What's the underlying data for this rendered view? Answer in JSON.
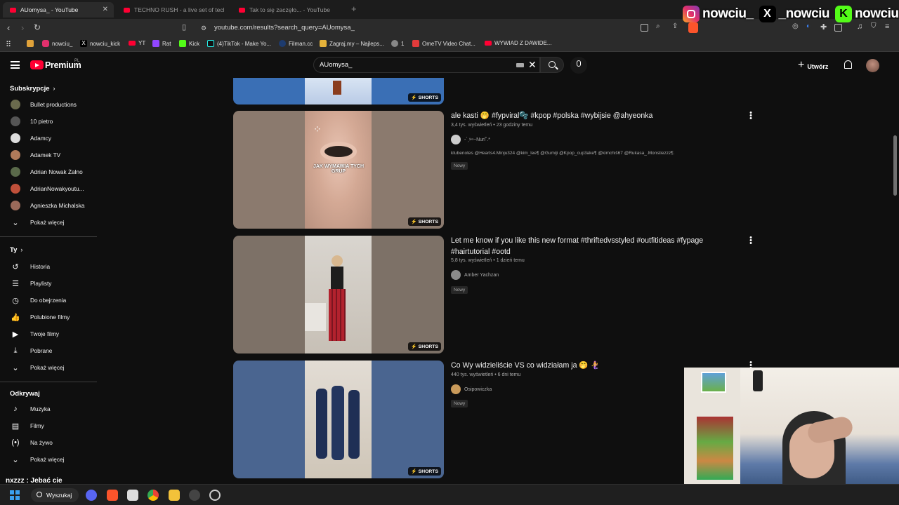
{
  "browser": {
    "tabs": [
      {
        "title": "AUomysa_ - YouTube",
        "active": true
      },
      {
        "title": "TECHNO RUSH - a live set of techno",
        "active": false
      },
      {
        "title": "Tak to się zaczęło... - YouTube",
        "active": false
      }
    ],
    "url": "youtube.com/results?search_query=AUomysa_",
    "bookmarks": [
      "nowciu_",
      "nowciu_kick",
      "YT",
      "Rat",
      "Kick",
      "(4)TikTok - Make Yo...",
      "Filman.cc",
      "Zagraj.my – Najleps...",
      "1",
      "OmeTV Video Chat...",
      "WYWIAD Z DAWIDE..."
    ]
  },
  "overlay": {
    "socials": [
      {
        "handle": "nowciu_",
        "icon": "instagram-icon",
        "color": "#e1306c"
      },
      {
        "handle": "_nowciu",
        "icon": "x-icon",
        "color": "#000000"
      },
      {
        "handle": "nowciu",
        "icon": "kick-icon",
        "color": "#53fc18"
      }
    ],
    "chat_message": "nxzzz : Jebać cie"
  },
  "youtube": {
    "brand": "Premium",
    "region": "PL",
    "search_query": "AUomysa_",
    "create_label": "Utwórz"
  },
  "sidebar": {
    "subscriptions_header": "Subskrypcje",
    "subscriptions": [
      "Bullet productions",
      "10 pietro",
      "Adamcy",
      "Adamek TV",
      "Adrian Nowak Żalno",
      "AdrianNowakyoutu...",
      "Agnieszka Michalska"
    ],
    "show_more_1": "Pokaż więcej",
    "you_header": "Ty",
    "you_items": [
      "Historia",
      "Playlisty",
      "Do obejrzenia",
      "Polubione filmy",
      "Twoje filmy",
      "Pobrane"
    ],
    "show_more_2": "Pokaż więcej",
    "explore_header": "Odkrywaj",
    "explore_items": [
      "Muzyka",
      "Filmy",
      "Na żywo"
    ],
    "show_more_3": "Pokaż więcej"
  },
  "results": [
    {
      "title": "ale kasti 🤭 #fypviral🫧 #kpop #polska #wybijsie @ahyeonka",
      "meta": "3,4 tys. wyświetleń • 23 godziny temu",
      "channel": "-ˋˏ✄┈Nuri˚.*",
      "description": "ktubenotes @Hearts4.Minju324 @kim_lee¶ @Gumiji @Kpop_cup3ake¶ @kimchiš67 @Rukasa_.Monstiezzz¶.",
      "badge": "Nowy",
      "shorts_label": "SHORTS",
      "thumb_text": "JAK WYMAWIA TYCH GRUP"
    },
    {
      "title": "Let me know if you like this new format #thriftedvsstyled #outfitideas #fypage #hairtutorial #ootd",
      "meta": "5,8 tys. wyświetleń • 1 dzień temu",
      "channel": "Amber Yachzan",
      "badge": "Nowy",
      "shorts_label": "SHORTS"
    },
    {
      "title": "Co Wy widzieliście VS co widziałam ja 🤭 🧜‍♀️",
      "meta": "440 tys. wyświetleń • 6 dni temu",
      "channel": "Osipowiczka",
      "badge": "Nowy",
      "shorts_label": "SHORTS"
    }
  ],
  "top_partial": {
    "shorts_label": "SHORTS"
  },
  "taskbar": {
    "search_label": "Wyszukaj"
  }
}
